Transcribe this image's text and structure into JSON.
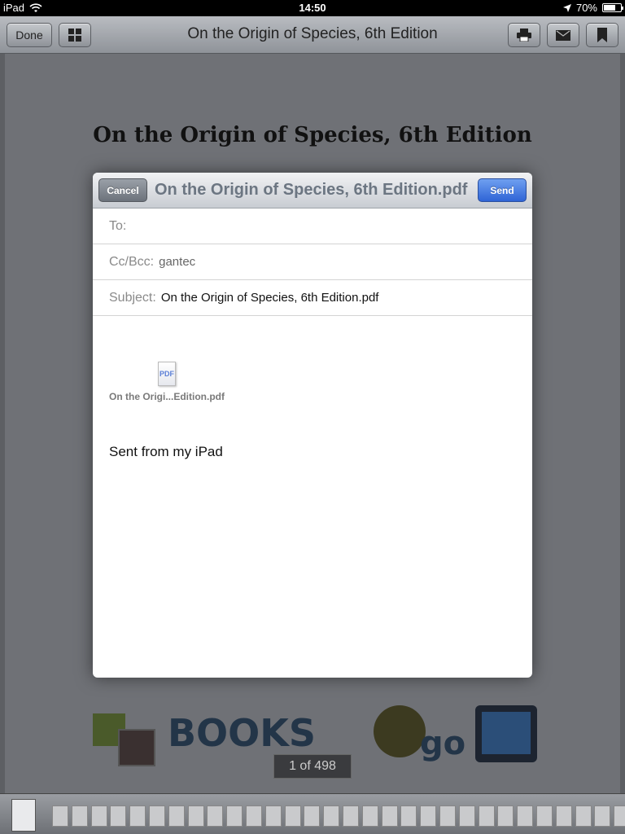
{
  "status_bar": {
    "device": "iPad",
    "time": "14:50",
    "battery": "70%",
    "battery_level": 0.7
  },
  "toolbar": {
    "done_label": "Done",
    "title": "On the Origin of Species, 6th Edition",
    "icons": [
      "grid-icon",
      "print-icon",
      "mail-icon",
      "bookmark-icon"
    ]
  },
  "document": {
    "title": "On the Origin of Species, 6th Edition",
    "page_indicator": "1 of 498"
  },
  "compose": {
    "cancel_label": "Cancel",
    "send_label": "Send",
    "title": "On the Origin of Species, 6th Edition.pdf",
    "to_label": "To:",
    "to_value": "",
    "cc_label": "Cc/Bcc:",
    "cc_value": "gantec",
    "subject_label": "Subject:",
    "subject_value": "On the Origin of Species, 6th Edition.pdf",
    "attachment_icon_text": "PDF",
    "attachment_name": "On the Origi...Edition.pdf",
    "signature": "Sent from my iPad"
  },
  "colors": {
    "send_button": "#2f64d6",
    "toolbar": "#a3a6ab",
    "dim_background": "#6f7176"
  }
}
